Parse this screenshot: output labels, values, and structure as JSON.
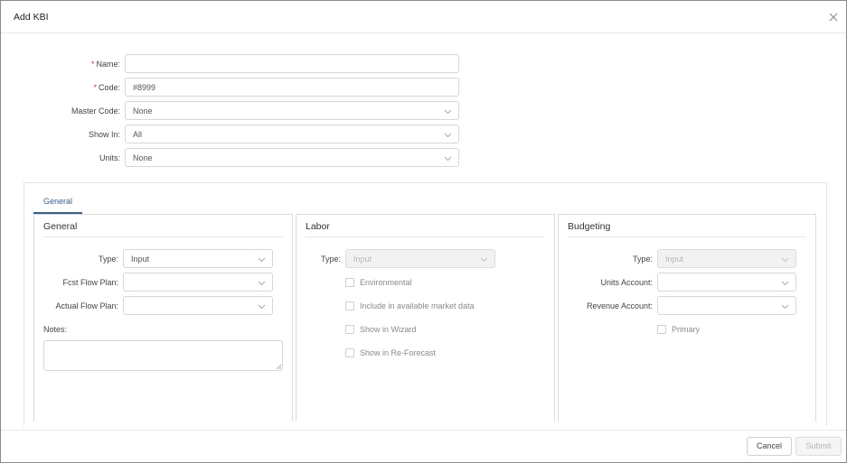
{
  "dialog": {
    "title": "Add KBI"
  },
  "form": {
    "name": {
      "label": "Name:",
      "required_mark": "*",
      "value": ""
    },
    "code": {
      "label": "Code:",
      "required_mark": "*",
      "value": "#8999"
    },
    "master_code": {
      "label": "Master Code:",
      "value": "None"
    },
    "show_in": {
      "label": "Show In:",
      "value": "All"
    },
    "units": {
      "label": "Units:",
      "value": "None"
    }
  },
  "tabs": [
    {
      "label": "General",
      "active": true
    }
  ],
  "panels": {
    "general": {
      "title": "General",
      "type": {
        "label": "Type:",
        "value": "Input"
      },
      "fcst_flow_plan": {
        "label": "Fcst Flow Plan:",
        "value": ""
      },
      "actual_flow_plan": {
        "label": "Actual Flow Plan:",
        "value": ""
      },
      "notes": {
        "label": "Notes:",
        "value": ""
      }
    },
    "labor": {
      "title": "Labor",
      "type": {
        "label": "Type:",
        "value": "Input"
      },
      "checkboxes": [
        "Environmental",
        "Include in available market data",
        "Show in Wizard",
        "Show in Re-Forecast"
      ]
    },
    "budgeting": {
      "title": "Budgeting",
      "type": {
        "label": "Type:",
        "value": "Input"
      },
      "units_account": {
        "label": "Units Account:",
        "value": ""
      },
      "revenue_account": {
        "label": "Revenue Account:",
        "value": ""
      },
      "primary": {
        "label": "Primary"
      }
    }
  },
  "footer": {
    "cancel_label": "Cancel",
    "submit_label": "Submit"
  },
  "colors": {
    "accent": "#2f5f9e",
    "required": "#e23a3a",
    "border": "#d6d6d6"
  },
  "icons": {
    "close": "close-icon",
    "dropdown": "chevron-down-icon"
  }
}
